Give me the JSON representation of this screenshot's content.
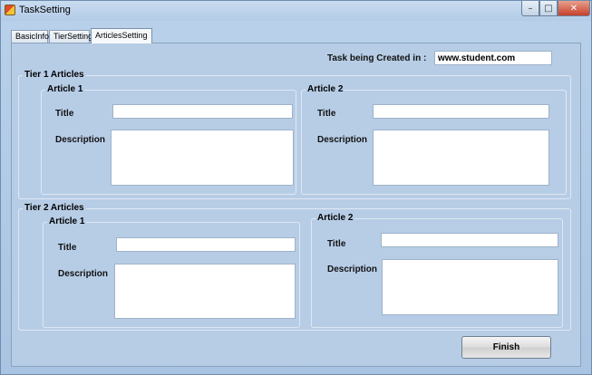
{
  "window": {
    "title": "TaskSetting",
    "icon": "app-icon",
    "controls": {
      "minimize": "–",
      "maximize": "□",
      "close": "✕"
    }
  },
  "tabs": [
    {
      "label": "BasicInfo",
      "selected": false
    },
    {
      "label": "TierSetting",
      "selected": false
    },
    {
      "label": "ArticlesSetting",
      "selected": true
    }
  ],
  "task": {
    "label": "Task being Created in :",
    "value": "www.student.com"
  },
  "tier1": {
    "title": "Tier 1 Articles",
    "article1": {
      "title": "Article 1",
      "title_label": "Title",
      "description_label": "Description",
      "title_value": "",
      "description_value": ""
    },
    "article2": {
      "title": "Article 2",
      "title_label": "Title",
      "description_label": "Description",
      "title_value": "",
      "description_value": ""
    }
  },
  "tier2": {
    "title": "Tier 2 Articles",
    "article1": {
      "title": "Article 1",
      "title_label": "Title",
      "description_label": "Description",
      "title_value": "",
      "description_value": ""
    },
    "article2": {
      "title": "Article 2",
      "title_label": "Title",
      "description_label": "Description",
      "title_value": "",
      "description_value": ""
    }
  },
  "finish_label": "Finish"
}
